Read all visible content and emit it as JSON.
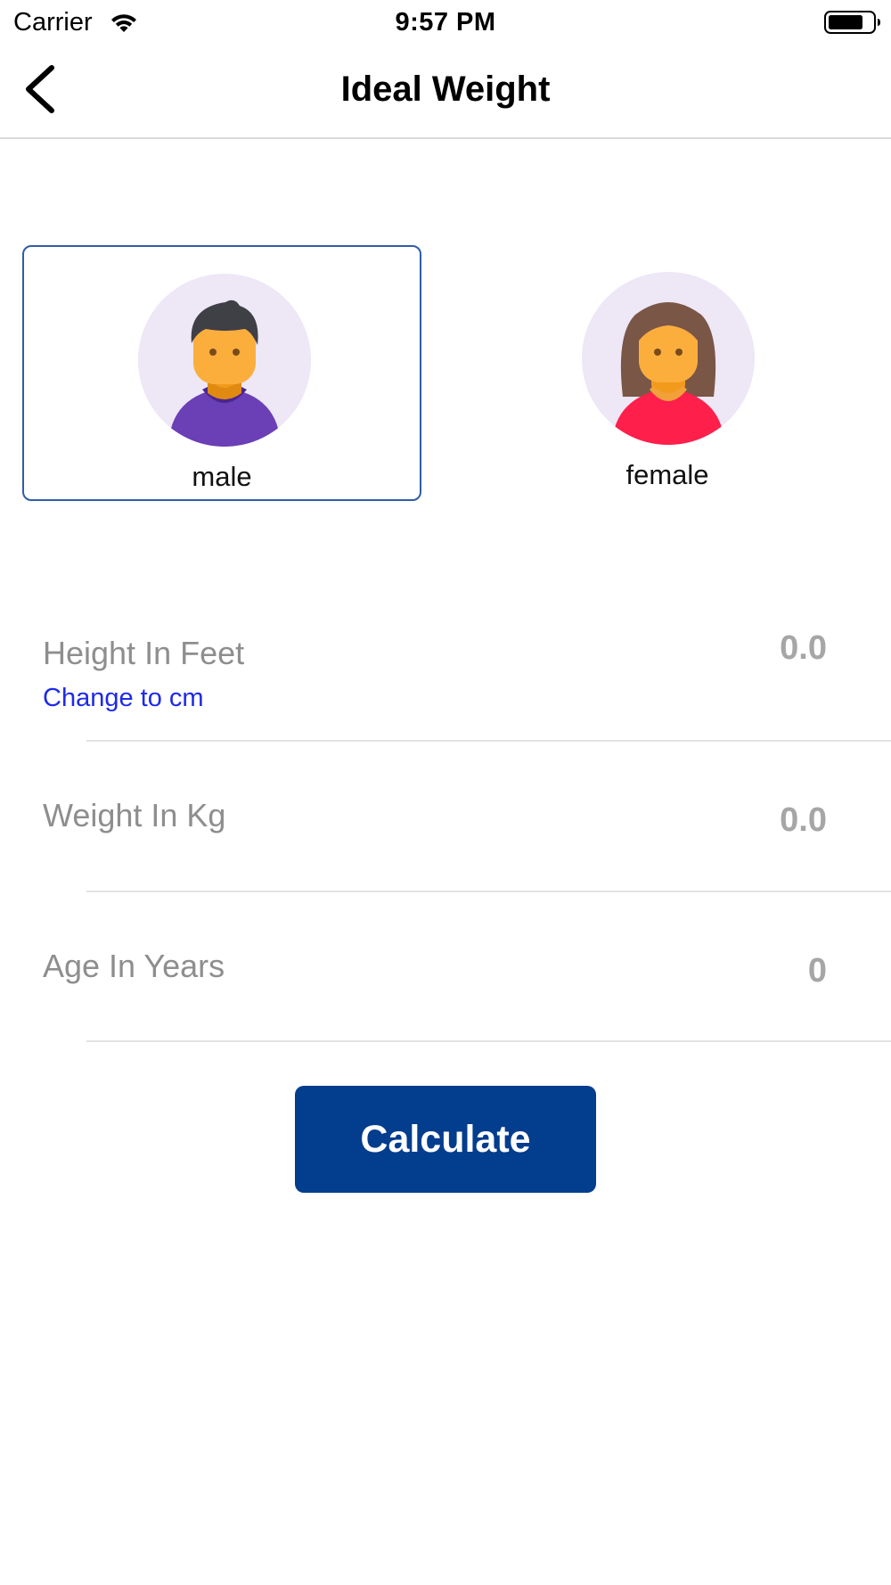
{
  "status_bar": {
    "carrier": "Carrier",
    "time": "9:57 PM",
    "wifi_icon": "wifi-icon",
    "battery_icon": "battery-icon"
  },
  "nav": {
    "title": "Ideal Weight",
    "back_icon": "chevron-left-icon"
  },
  "gender": {
    "selected": "male",
    "options": [
      {
        "label": "male",
        "avatar_icon": "male-avatar-icon"
      },
      {
        "label": "female",
        "avatar_icon": "female-avatar-icon"
      }
    ]
  },
  "form": {
    "height": {
      "label": "Height In Feet",
      "value": "0.0",
      "unit_toggle": "Change to cm"
    },
    "weight": {
      "label": "Weight In Kg",
      "value": "0.0"
    },
    "age": {
      "label": "Age In Years",
      "value": "0"
    }
  },
  "actions": {
    "calculate_label": "Calculate"
  },
  "colors": {
    "primary": "#033d8e",
    "link": "#1e2ae6",
    "selected_border": "#2f5da8",
    "avatar_bg": "#ede7f6"
  }
}
